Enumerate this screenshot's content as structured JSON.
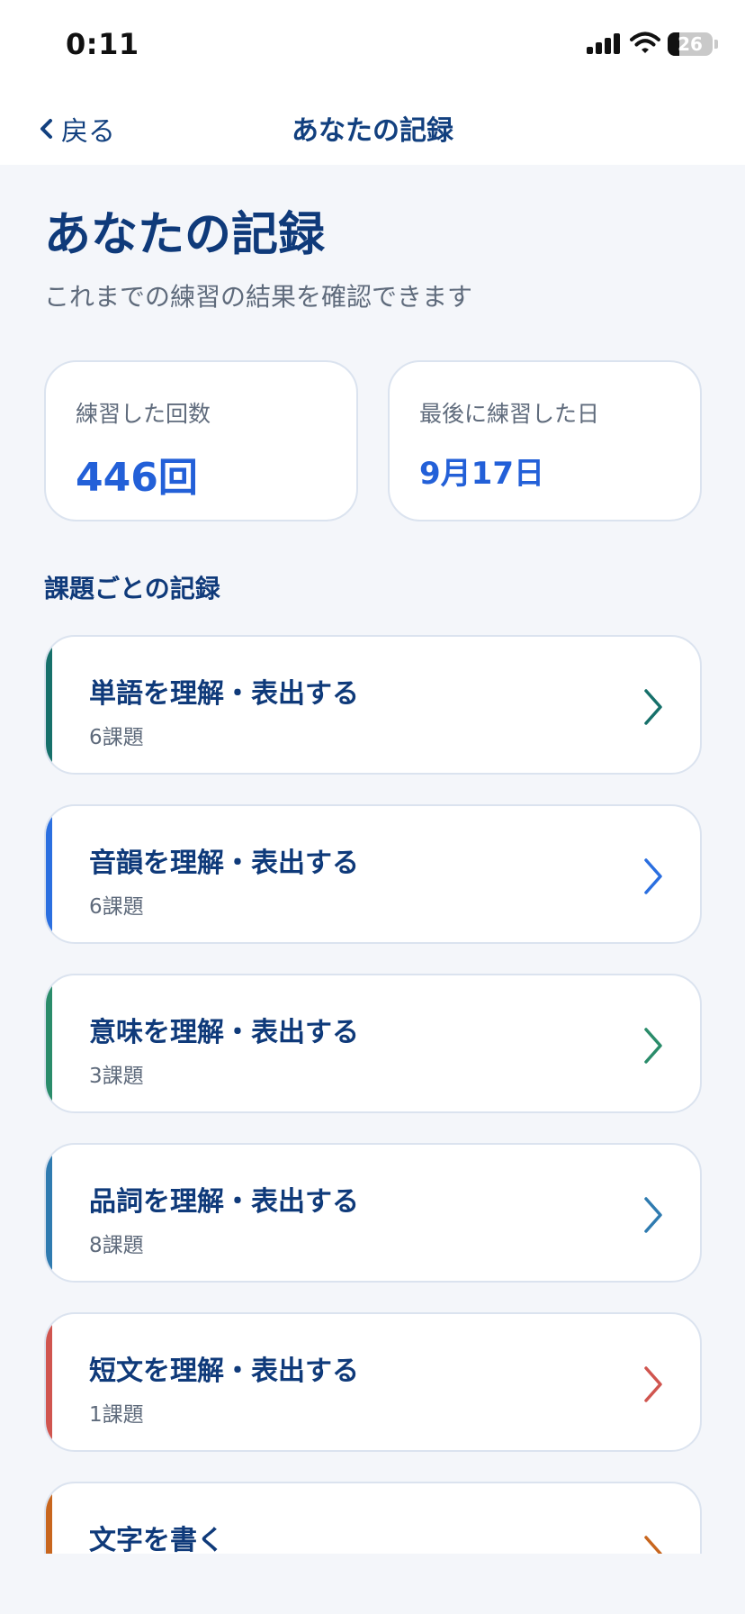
{
  "status_bar": {
    "time": "0:11",
    "battery": "26",
    "icons": [
      "signal-icon",
      "wifi-icon",
      "battery-icon"
    ]
  },
  "nav": {
    "back_label": "戻る",
    "title": "あなたの記録"
  },
  "header": {
    "title": "あなたの記録",
    "subtitle": "これまでの練習の結果を確認できます"
  },
  "stats": [
    {
      "label": "練習した回数",
      "value": "446回"
    },
    {
      "label": "最後に練習した日",
      "value": "9月17日"
    }
  ],
  "section_heading": "課題ごとの記録",
  "categories": [
    {
      "title": "単語を理解・表出する",
      "count": "6課題",
      "color": "#16706a"
    },
    {
      "title": "音韻を理解・表出する",
      "count": "6課題",
      "color": "#2b6fe0"
    },
    {
      "title": "意味を理解・表出する",
      "count": "3課題",
      "color": "#2a8c6a"
    },
    {
      "title": "品詞を理解・表出する",
      "count": "8課題",
      "color": "#2f7bb0"
    },
    {
      "title": "短文を理解・表出する",
      "count": "1課題",
      "color": "#d0554f"
    },
    {
      "title": "文字を書く",
      "count": "",
      "color": "#c8661e"
    }
  ],
  "colors": {
    "accent_blue": "#2360d8",
    "title_navy": "#0f3a7a",
    "background": "#f4f6fa"
  }
}
